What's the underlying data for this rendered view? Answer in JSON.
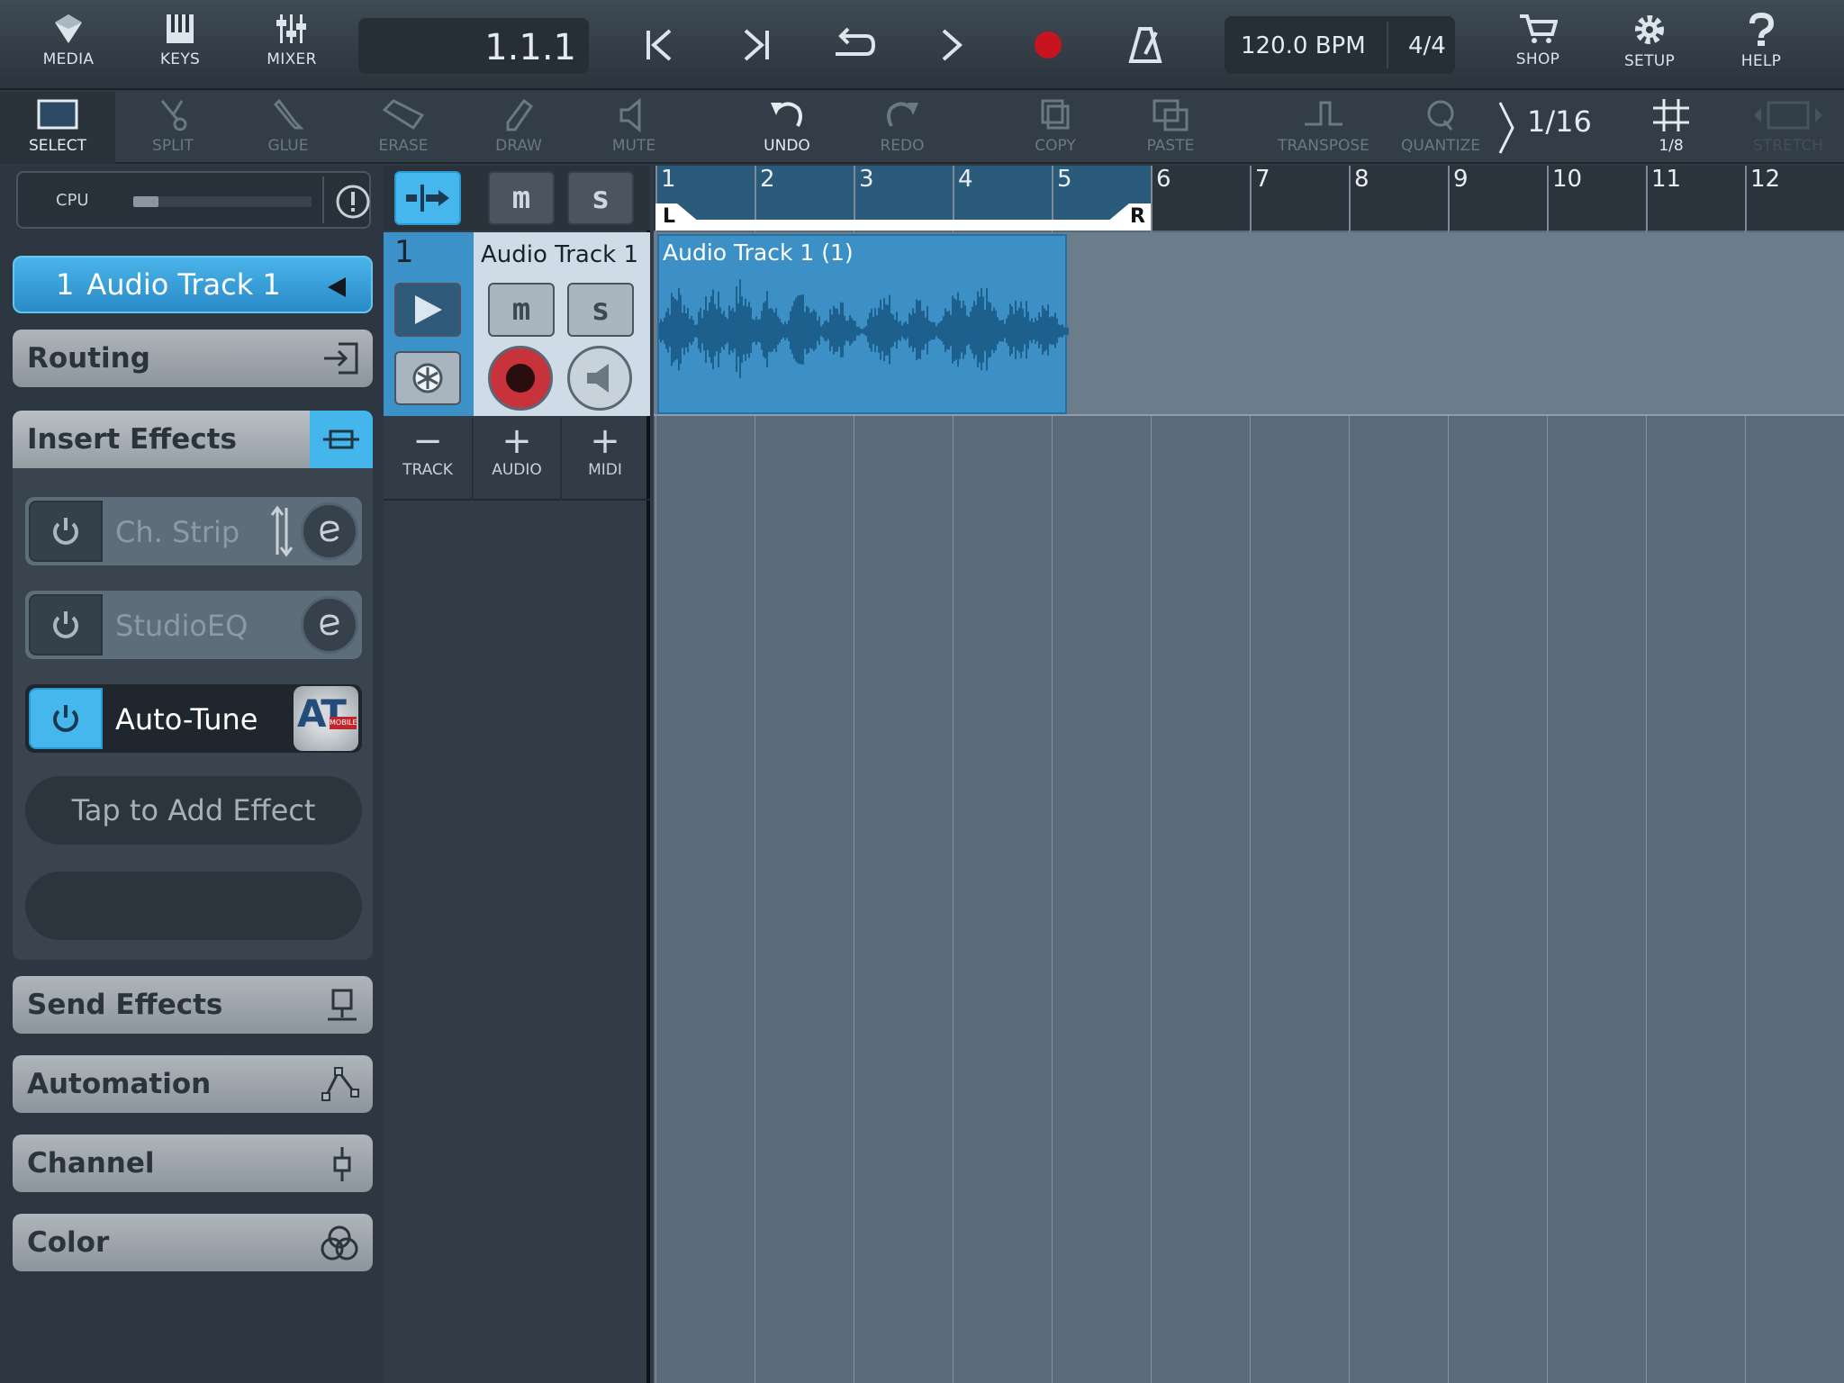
{
  "topbar": {
    "media_label": "MEDIA",
    "keys_label": "KEYS",
    "mixer_label": "MIXER",
    "position": "1.1.1",
    "tempo": "120.0 BPM",
    "meter": "4/4",
    "shop_label": "SHOP",
    "setup_label": "SETUP",
    "help_label": "HELP",
    "record_color": "#c8141e"
  },
  "toolbar": {
    "select_label": "SELECT",
    "split_label": "SPLIT",
    "glue_label": "GLUE",
    "erase_label": "ERASE",
    "draw_label": "DRAW",
    "mute_label": "MUTE",
    "undo_label": "UNDO",
    "redo_label": "REDO",
    "copy_label": "COPY",
    "paste_label": "PASTE",
    "transpose_label": "TRANSPOSE",
    "quantize_label": "QUANTIZE",
    "quantize_value": "1/16",
    "grid_label": "1/8",
    "stretch_label": "STRETCH"
  },
  "inspector": {
    "cpu_label": "CPU",
    "cpu_load": 0.14,
    "track_number": "1",
    "track_name": "Audio Track 1",
    "routing_label": "Routing",
    "insert_effects_label": "Insert Effects",
    "effects": [
      {
        "name": "Ch. Strip",
        "enabled": false
      },
      {
        "name": "StudioEQ",
        "enabled": false
      },
      {
        "name": "Auto-Tune",
        "enabled": true,
        "logo_text": "AT",
        "logo_badge": "MOBILE"
      }
    ],
    "add_effect_label": "Tap to Add Effect",
    "send_effects_label": "Send Effects",
    "automation_label": "Automation",
    "channel_label": "Channel",
    "color_label": "Color",
    "accent_color": "#45b7ec"
  },
  "tracklist": {
    "mute_glyph": "m",
    "solo_glyph": "s",
    "track_number": "1",
    "track_name": "Audio Track 1",
    "remove_track_label": "TRACK",
    "add_audio_label": "AUDIO",
    "add_midi_label": "MIDI",
    "remove_sign": "−",
    "add_sign": "+"
  },
  "arrange": {
    "bars": [
      "1",
      "2",
      "3",
      "4",
      "5",
      "6",
      "7",
      "8",
      "9",
      "10",
      "11",
      "12"
    ],
    "loop_left_label": "L",
    "loop_right_label": "R",
    "loop_start_bar": 1,
    "loop_end_bar": 6,
    "clip_name": "Audio Track 1 (1)",
    "clip_start_bar": 1,
    "clip_end_bar": 5.15
  }
}
